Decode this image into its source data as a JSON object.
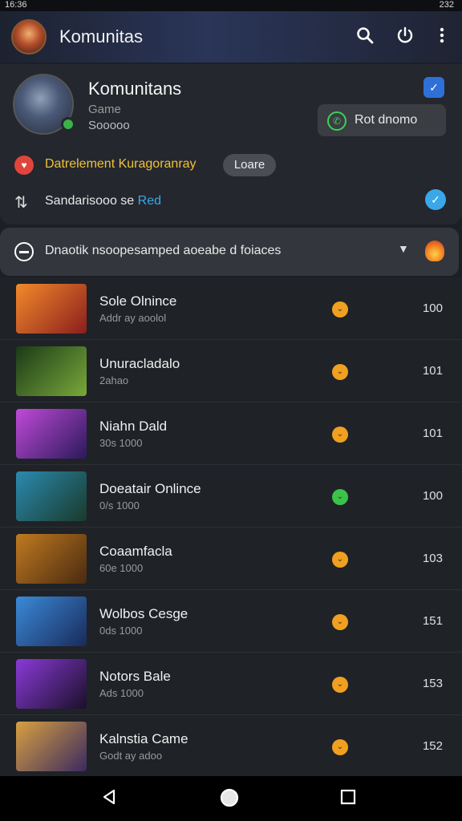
{
  "status_bar": {
    "time": "16:36",
    "right": "232"
  },
  "app_bar": {
    "title": "Komunitas",
    "search_icon": "search-icon",
    "power_icon": "power-icon",
    "menu_icon": "more-vert-icon"
  },
  "profile": {
    "name": "Komunitans",
    "sub1": "Game",
    "sub2": "Sooooo",
    "status_button": "Rot dnomo",
    "row1_text": "Datrelement Kuragoranray",
    "row1_pill": "Loare",
    "row2_text": "Sandarisooo se",
    "row2_accent": "Red"
  },
  "filter": {
    "text": "Dnaotik nsoopesamped aoeabe d foiaces"
  },
  "items": [
    {
      "title": "Sole Olnince",
      "sub": "Addr ay aoolol",
      "count": "100",
      "dot": "orange",
      "thumb": [
        "#f28a2a",
        "#8a1e1e"
      ]
    },
    {
      "title": "Unuracladalo",
      "sub": "2ahao",
      "count": "101",
      "dot": "orange",
      "thumb": [
        "#1a3a18",
        "#7aa83a"
      ]
    },
    {
      "title": "Niahn Dald",
      "sub": "30s 1000",
      "count": "101",
      "dot": "orange",
      "thumb": [
        "#c04ad8",
        "#2a1a5a"
      ]
    },
    {
      "title": "Doeatair Onlince",
      "sub": "0/s 1000",
      "count": "100",
      "dot": "green",
      "thumb": [
        "#2a8ab0",
        "#1a3a2a"
      ]
    },
    {
      "title": "Coaamfacla",
      "sub": "60e 1000",
      "count": "103",
      "dot": "orange",
      "thumb": [
        "#c07a20",
        "#4a2a10"
      ]
    },
    {
      "title": "Wolbos Cesge",
      "sub": "0ds 1000",
      "count": "151",
      "dot": "orange",
      "thumb": [
        "#3a8ad8",
        "#1a2a5a"
      ]
    },
    {
      "title": "Notors Bale",
      "sub": "Ads 1000",
      "count": "153",
      "dot": "orange",
      "thumb": [
        "#8a3ad8",
        "#1a1028"
      ]
    },
    {
      "title": "Kalnstia Came",
      "sub": "Godt ay adoo",
      "count": "152",
      "dot": "orange",
      "thumb": [
        "#d8a040",
        "#3a2a60"
      ]
    }
  ],
  "colors": {
    "accent_blue": "#3aa8e8",
    "orange_dot": "#f0a020",
    "green_dot": "#3bc24a",
    "yellow_text": "#f0c23a"
  },
  "nav": {
    "back_icon": "back-triangle-icon",
    "home_icon": "home-circle-icon",
    "recents_icon": "recents-square-icon"
  }
}
